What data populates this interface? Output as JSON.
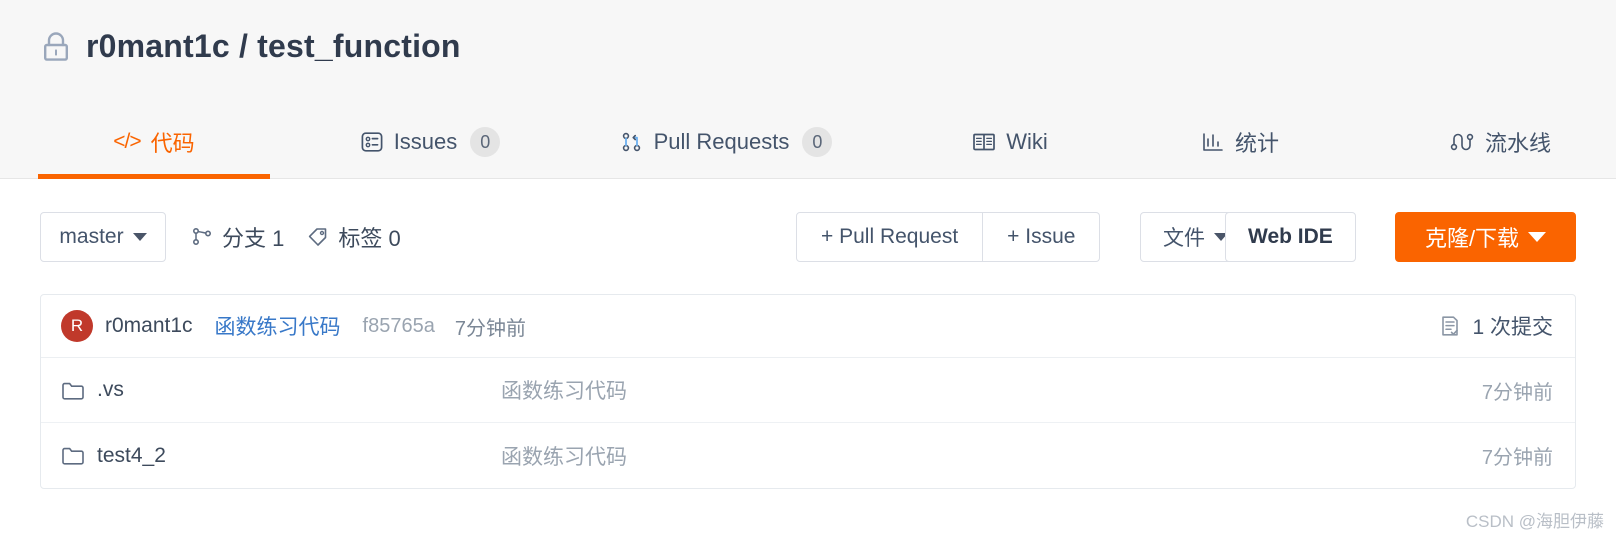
{
  "header": {
    "visibility_icon": "lock-icon",
    "owner": "r0mant1c",
    "separator": "/",
    "repo": "test_function",
    "title": "r0mant1c / test_function"
  },
  "tabs": [
    {
      "id": "code",
      "label": "代码",
      "icon": "code-icon",
      "badge": null,
      "active": true
    },
    {
      "id": "issues",
      "label": "Issues",
      "icon": "issue-list-icon",
      "badge": "0",
      "active": false
    },
    {
      "id": "pulls",
      "label": "Pull Requests",
      "icon": "git-pull-request-icon",
      "badge": "0",
      "active": false
    },
    {
      "id": "wiki",
      "label": "Wiki",
      "icon": "book-icon",
      "badge": null,
      "active": false
    },
    {
      "id": "stats",
      "label": "统计",
      "icon": "bar-chart-icon",
      "badge": null,
      "active": false
    },
    {
      "id": "pipeline",
      "label": "流水线",
      "icon": "pipeline-icon",
      "badge": null,
      "active": false
    }
  ],
  "toolbar": {
    "branch_selected": "master",
    "branches_label": "分支 1",
    "tags_label": "标签 0",
    "new_pull_request": "+ Pull Request",
    "new_issue": "+ Issue",
    "files_label": "文件",
    "web_ide_label": "Web IDE",
    "clone_label": "克隆/下载"
  },
  "commit_bar": {
    "avatar_initial": "R",
    "avatar_color": "#c0392b",
    "author": "r0mant1c",
    "message": "函数练习代码",
    "hash": "f85765a",
    "time": "7分钟前",
    "commit_count": "1 次提交"
  },
  "files": [
    {
      "name": ".vs",
      "type": "folder",
      "message": "函数练习代码",
      "time": "7分钟前"
    },
    {
      "name": "test4_2",
      "type": "folder",
      "message": "函数练习代码",
      "time": "7分钟前"
    }
  ],
  "watermark": "CSDN @海胆伊藤",
  "colors": {
    "accent": "#fa6400",
    "text": "#3d4a5c",
    "link": "#3878c8",
    "muted": "#9aa4b0",
    "header_bg": "#f7f7f7"
  }
}
